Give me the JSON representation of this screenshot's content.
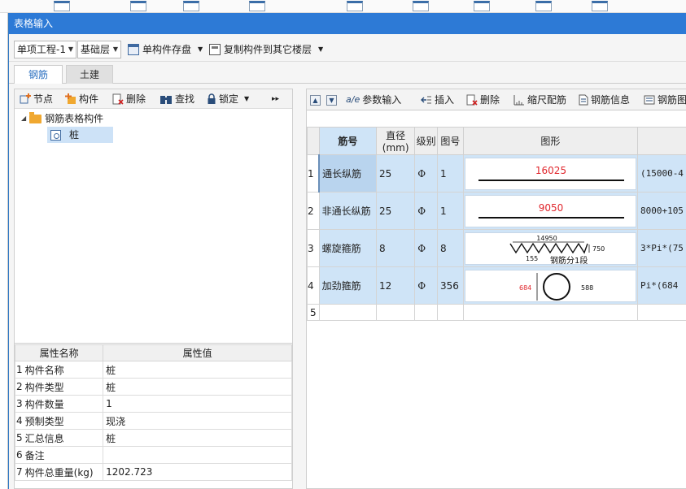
{
  "dialog": {
    "title": "表格输入"
  },
  "toolbar": {
    "project": "单项工程-1",
    "floor": "基础层",
    "save_label": "单构件存盘",
    "copy_label": "复制构件到其它楼层"
  },
  "tabs": [
    {
      "label": "钢筋",
      "active": true
    },
    {
      "label": "土建",
      "active": false
    }
  ],
  "left_toolbar": {
    "node": "节点",
    "component": "构件",
    "delete": "删除",
    "find": "查找",
    "lock": "锁定",
    "more": "▸▸"
  },
  "tree": {
    "root": "钢筋表格构件",
    "child": "桩"
  },
  "props": {
    "headers": [
      "属性名称",
      "属性值"
    ],
    "rows": [
      {
        "num": "1",
        "name": "构件名称",
        "value": "桩"
      },
      {
        "num": "2",
        "name": "构件类型",
        "value": "桩"
      },
      {
        "num": "3",
        "name": "构件数量",
        "value": "1"
      },
      {
        "num": "4",
        "name": "预制类型",
        "value": "现浇"
      },
      {
        "num": "5",
        "name": "汇总信息",
        "value": "桩"
      },
      {
        "num": "6",
        "name": "备注",
        "value": ""
      },
      {
        "num": "7",
        "name": "构件总重量(kg)",
        "value": "1202.723"
      }
    ]
  },
  "right_toolbar": {
    "param": "参数输入",
    "insert": "插入",
    "delete": "删除",
    "ruler": "缩尺配筋",
    "info": "钢筋信息",
    "library": "钢筋图库"
  },
  "grid": {
    "headers": [
      "筋号",
      "直径(mm)",
      "级别",
      "图号",
      "图形",
      ""
    ],
    "rows": [
      {
        "num": "1",
        "name": "通长纵筋",
        "dia": "25",
        "grade": "Φ",
        "fig": "1",
        "shape_label": "16025",
        "formula": "(15000-4"
      },
      {
        "num": "2",
        "name": "非通长纵筋",
        "dia": "25",
        "grade": "Φ",
        "fig": "1",
        "shape_label": "9050",
        "formula": "8000+105"
      },
      {
        "num": "3",
        "name": "螺旋箍筋",
        "dia": "8",
        "grade": "Φ",
        "fig": "8",
        "shape_top": "14950",
        "shape_side": "750",
        "shape_pitch": "155",
        "shape_note": "钢筋分1段",
        "formula": "3*Pi*(75"
      },
      {
        "num": "4",
        "name": "加劲箍筋",
        "dia": "12",
        "grade": "Φ",
        "fig": "356",
        "shape_left": "684",
        "shape_right": "588",
        "formula": "Pi*(684"
      },
      {
        "num": "5"
      }
    ]
  },
  "colors": {
    "title_bar": "#2d7ad6",
    "row_highlight": "#cfe4f7",
    "dimension_red": "#e0262c"
  }
}
